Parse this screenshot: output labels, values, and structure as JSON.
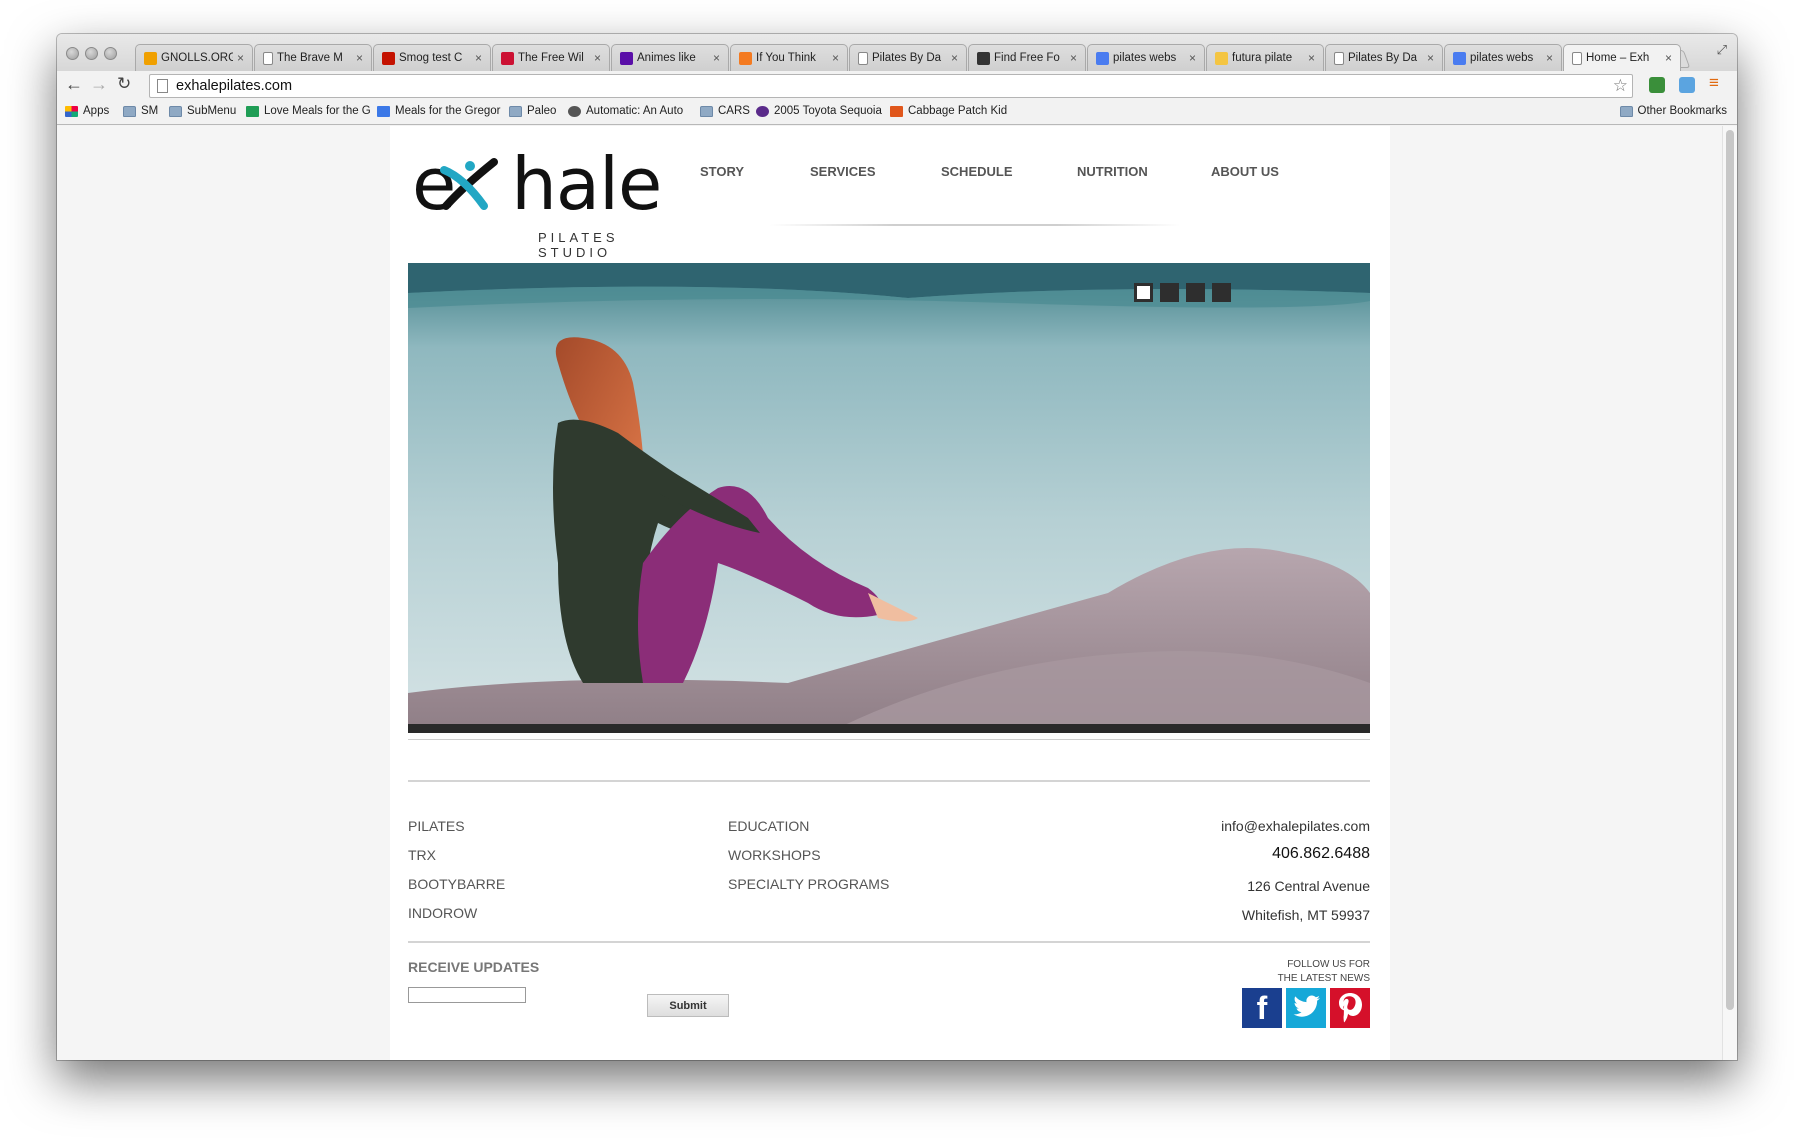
{
  "browser": {
    "tabs": [
      {
        "title": "GNOLLS.ORG",
        "icon": "cloud-icon",
        "color": "#f0a000"
      },
      {
        "title": "The Brave M",
        "icon": "page-icon",
        "color": "#ffffff"
      },
      {
        "title": "Smog test C",
        "icon": "yelp-icon",
        "color": "#c41200"
      },
      {
        "title": "The Free Wil",
        "icon": "flag-icon",
        "color": "#cc1133"
      },
      {
        "title": "Animes like",
        "icon": "yahoo-icon",
        "color": "#5a0fa8"
      },
      {
        "title": "If You Think",
        "icon": "upworthy-icon",
        "color": "#f47a20"
      },
      {
        "title": "Pilates By Da",
        "icon": "page-icon",
        "color": "#ffffff"
      },
      {
        "title": "Find Free Fo",
        "icon": "figure-icon",
        "color": "#333333"
      },
      {
        "title": "pilates webs",
        "icon": "google-icon",
        "color": "#4a7cf0"
      },
      {
        "title": "futura pilate",
        "icon": "chart-icon",
        "color": "#f4c542"
      },
      {
        "title": "Pilates By Da",
        "icon": "page-icon",
        "color": "#ffffff"
      },
      {
        "title": "pilates webs",
        "icon": "google-icon",
        "color": "#4a7cf0"
      },
      {
        "title": "Home – Exh",
        "icon": "page-icon",
        "color": "#ffffff",
        "active": true
      }
    ],
    "url": "exhalepilates.com",
    "bookmarks": [
      {
        "label": "Apps",
        "icon": "apps-grid-icon"
      },
      {
        "label": "SM",
        "icon": "folder-icon"
      },
      {
        "label": "SubMenu",
        "icon": "folder-icon"
      },
      {
        "label": "Love Meals for the G",
        "icon": "sheets-icon"
      },
      {
        "label": "Meals for the Gregor",
        "icon": "docs-icon"
      },
      {
        "label": "Paleo",
        "icon": "folder-icon"
      },
      {
        "label": "Automatic: An Auto",
        "icon": "automatic-icon"
      },
      {
        "label": "CARS",
        "icon": "folder-icon"
      },
      {
        "label": "2005 Toyota Sequoia",
        "icon": "peace-icon"
      },
      {
        "label": "Cabbage Patch Kid",
        "icon": "etsy-icon"
      }
    ],
    "other_bookmarks": "Other Bookmarks"
  },
  "site": {
    "logo": {
      "word_pre": "e",
      "word_post": "hale",
      "sub": "PILATES STUDIO"
    },
    "nav": [
      "STORY",
      "SERVICES",
      "SCHEDULE",
      "NUTRITION",
      "ABOUT US"
    ],
    "slider": {
      "slides": 4,
      "active": 1
    },
    "services_col1": [
      "PILATES",
      "TRX",
      "BOOTYBARRE",
      "INDOROW"
    ],
    "services_col2": [
      "EDUCATION",
      "WORKSHOPS",
      "SPECIALTY PROGRAMS"
    ],
    "contact": {
      "email": "info@exhalepilates.com",
      "phone": "406.862.6488",
      "street": "126 Central Avenue",
      "city": "Whitefish, MT 59937"
    },
    "updates": {
      "title": "RECEIVE UPDATES",
      "submit": "Submit",
      "input_value": ""
    },
    "follow": {
      "line1": "FOLLOW US FOR",
      "line2": "THE LATEST NEWS"
    },
    "social": [
      {
        "name": "facebook",
        "glyph": "f",
        "color": "#1a3f8f"
      },
      {
        "name": "twitter",
        "glyph": "t",
        "color": "#16a8d8"
      },
      {
        "name": "pinterest",
        "glyph": "p",
        "color": "#d5102a"
      }
    ]
  }
}
